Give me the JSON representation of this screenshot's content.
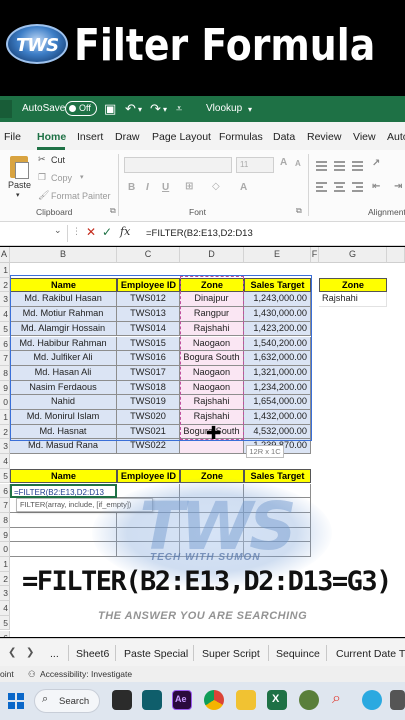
{
  "banner": {
    "logo_text": "TWS",
    "title": "Filter Formula"
  },
  "titlebar": {
    "autosave_label": "AutoSave",
    "toggle_state": "Off",
    "file_name": "Vlookup"
  },
  "menu": {
    "tabs": [
      "File",
      "Home",
      "Insert",
      "Draw",
      "Page Layout",
      "Formulas",
      "Data",
      "Review",
      "View",
      "Auto"
    ],
    "active": "Home"
  },
  "ribbon": {
    "cut": "Cut",
    "copy": "Copy",
    "format_painter": "Format Painter",
    "paste": "Paste",
    "clipboard_label": "Clipboard",
    "font_label": "Font",
    "alignment_label": "Alignment",
    "font_size": "11"
  },
  "formula_bar": {
    "fx": "fx",
    "formula": "=FILTER(B2:E13,D2:D13"
  },
  "columns": [
    "A",
    "B",
    "C",
    "D",
    "E",
    "F",
    "G"
  ],
  "rows": [
    "1",
    "2",
    "3",
    "4",
    "5",
    "6",
    "7",
    "8",
    "9",
    "0",
    "1",
    "2",
    "3",
    "4",
    "5",
    "6",
    "7",
    "8",
    "9",
    "0",
    "1",
    "2",
    "3",
    "4",
    "5",
    "6",
    "7"
  ],
  "table1": {
    "headers": [
      "Name",
      "Employee ID",
      "Zone",
      "Sales Target"
    ],
    "rows": [
      [
        "Md. Rakibul Hasan",
        "TWS012",
        "Dinajpur",
        "1,243,000.00"
      ],
      [
        "Md. Motiur Rahman",
        "TWS013",
        "Rangpur",
        "1,430,000.00"
      ],
      [
        "Md. Alamgir Hossain",
        "TWS014",
        "Rajshahi",
        "1,423,200.00"
      ],
      [
        "Md. Habibur Rahman",
        "TWS015",
        "Naogaon",
        "1,540,200.00"
      ],
      [
        "Md. Julfiker Ali",
        "TWS016",
        "Bogura South",
        "1,632,000.00"
      ],
      [
        "Md. Hasan Ali",
        "TWS017",
        "Naogaon",
        "1,321,000.00"
      ],
      [
        "Nasim Ferdaous",
        "TWS018",
        "Naogaon",
        "1,234,200.00"
      ],
      [
        "Nahid",
        "TWS019",
        "Rajshahi",
        "1,654,000.00"
      ],
      [
        "Md. Monirul Islam",
        "TWS020",
        "Rajshahi",
        "1,432,000.00"
      ],
      [
        "Md. Hasnat",
        "TWS021",
        "Bogura South",
        "4,532,000.00"
      ],
      [
        "Md. Masud Rana",
        "TWS022",
        "",
        "1,239,870.00"
      ]
    ]
  },
  "criteria": {
    "header": "Zone",
    "value": "Rajshahi"
  },
  "table2": {
    "headers": [
      "Name",
      "Employee ID",
      "Zone",
      "Sales Target"
    ],
    "editing_cell": "=FILTER(B2:E13,D2:D13"
  },
  "tooltip": "FILTER(array, include, [if_empty])",
  "dim_tip": "12R x 1C",
  "watermark": {
    "letters": "TWS",
    "subtitle": "TECH WITH SUMON",
    "tagline": "THE ANSWER YOU ARE SEARCHING"
  },
  "overlay_formula": "=FILTER(B2:E13,D2:D13=G3)",
  "sheets": [
    "Sheet6",
    "Paste Special",
    "Super Script",
    "Sequince",
    "Current Date T"
  ],
  "more_sheets": "...",
  "status": {
    "mode": "oint",
    "accessibility": "Accessibility: Investigate"
  },
  "taskbar": {
    "search": "Search"
  },
  "colors": {
    "excel_green": "#1e7145",
    "header_yellow": "#ffff00",
    "row_blue": "#dbe4f4",
    "zone_pink": "#fae6f3"
  }
}
